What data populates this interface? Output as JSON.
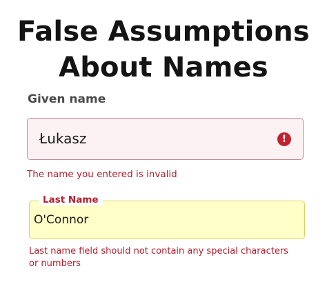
{
  "headline": {
    "line1": "False Assumptions",
    "line2": "About Names"
  },
  "given_name": {
    "label": "Given name",
    "value": "Łukasz",
    "error_icon_glyph": "!",
    "error": "The name you entered is invalid"
  },
  "last_name": {
    "label": "Last Name",
    "value": "O'Connor",
    "error": "Last name field should not contain any special characters or numbers"
  },
  "colors": {
    "error": "#b3202e",
    "given_field_bg": "#fdf2f3",
    "last_field_bg": "#ffffc7"
  }
}
